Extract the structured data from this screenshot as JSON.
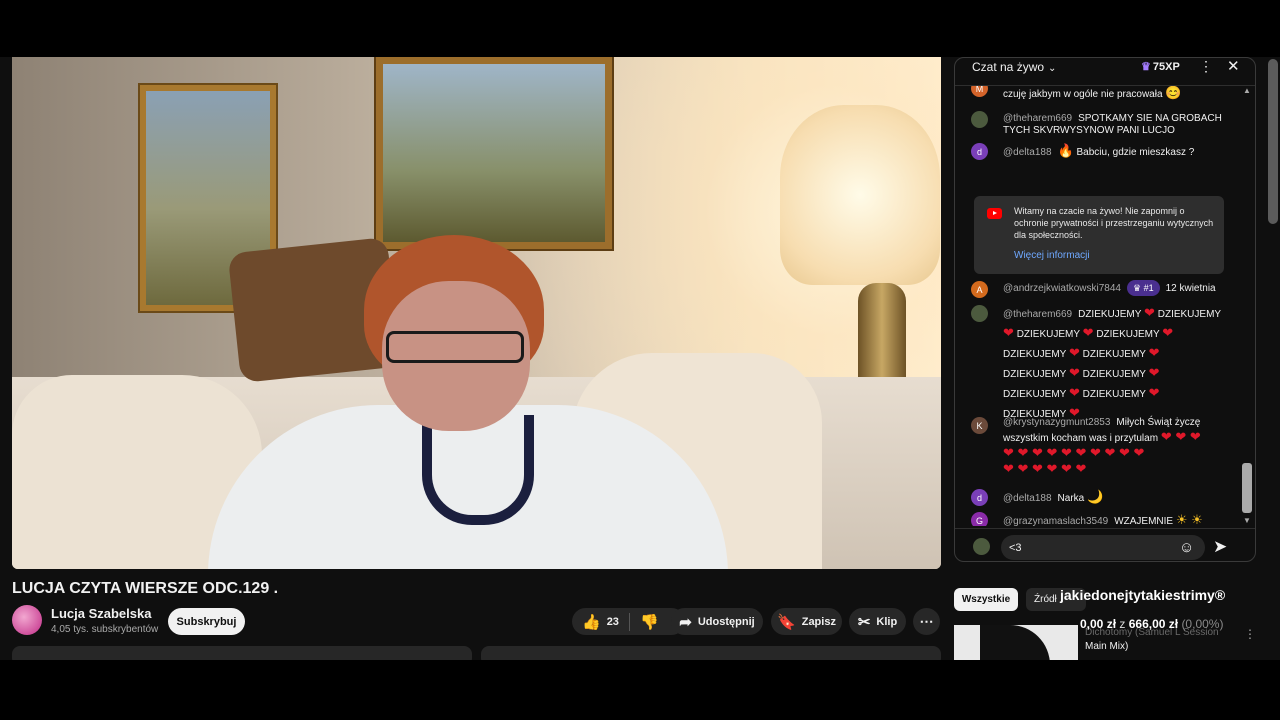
{
  "video": {
    "title": "LUCJA CZYTA WIERSZE ODC.129 ."
  },
  "channel": {
    "name": "Lucja Szabelska",
    "subscribers": "4,05 tys. subskrybentów",
    "subscribe_label": "Subskrybuj"
  },
  "actions": {
    "likes": "23",
    "share": "Udostępnij",
    "save": "Zapisz",
    "clip": "Klip",
    "more": "⋯"
  },
  "chat": {
    "title": "Czat na żywo",
    "xp": "75XP",
    "partial_line": "czuję jakbym w ogóle nie pracowała",
    "messages": [
      {
        "avatar": "",
        "author": "@theharem669",
        "text": "SPOTKAMY SIE NA GROBACH TYCH SKVRWYSYNOW PANI LUCJO"
      },
      {
        "avatar": "d",
        "author": "@delta188",
        "text": "Babciu, gdzie mieszkasz ?"
      },
      {
        "avatar": "A",
        "author": "@andrzejkwiatkowski7844",
        "badge": "#1",
        "text": "12 kwietnia"
      },
      {
        "avatar": "",
        "author": "@theharem669",
        "text": "DZIEKUJEMY"
      },
      {
        "avatar": "K",
        "author": "@krystynazygmunt2853",
        "text": "Miłych Świąt życzę wszystkim kocham was i przytulam"
      },
      {
        "avatar": "d",
        "author": "@delta188",
        "text": "Narka"
      },
      {
        "avatar": "G",
        "author": "@grazynamaslach3549",
        "text": "WZAJEMNIE"
      }
    ],
    "info_box": {
      "text": "Witamy na czacie na żywo! Nie zapomnij o ochronie prywatności i przestrzeganiu wytycznych dla społeczności.",
      "link": "Więcej informacji"
    },
    "input_value": "<3"
  },
  "filters": {
    "all": "Wszystkie",
    "sources": "Źródł"
  },
  "overlay": {
    "title": "jakiedonejtytakiestrimy®",
    "amount": "0,00 zł",
    "of": "z",
    "goal": "666,00 zł",
    "pct": "(0,00%)"
  },
  "recommended": {
    "title_line1": "Dichotomy (Samuel L Session",
    "title_line2": "Main Mix)"
  },
  "colors": {
    "accent_red": "#e0182a",
    "link_blue": "#6fa8ff",
    "badge_purple": "#4a2f8f"
  }
}
